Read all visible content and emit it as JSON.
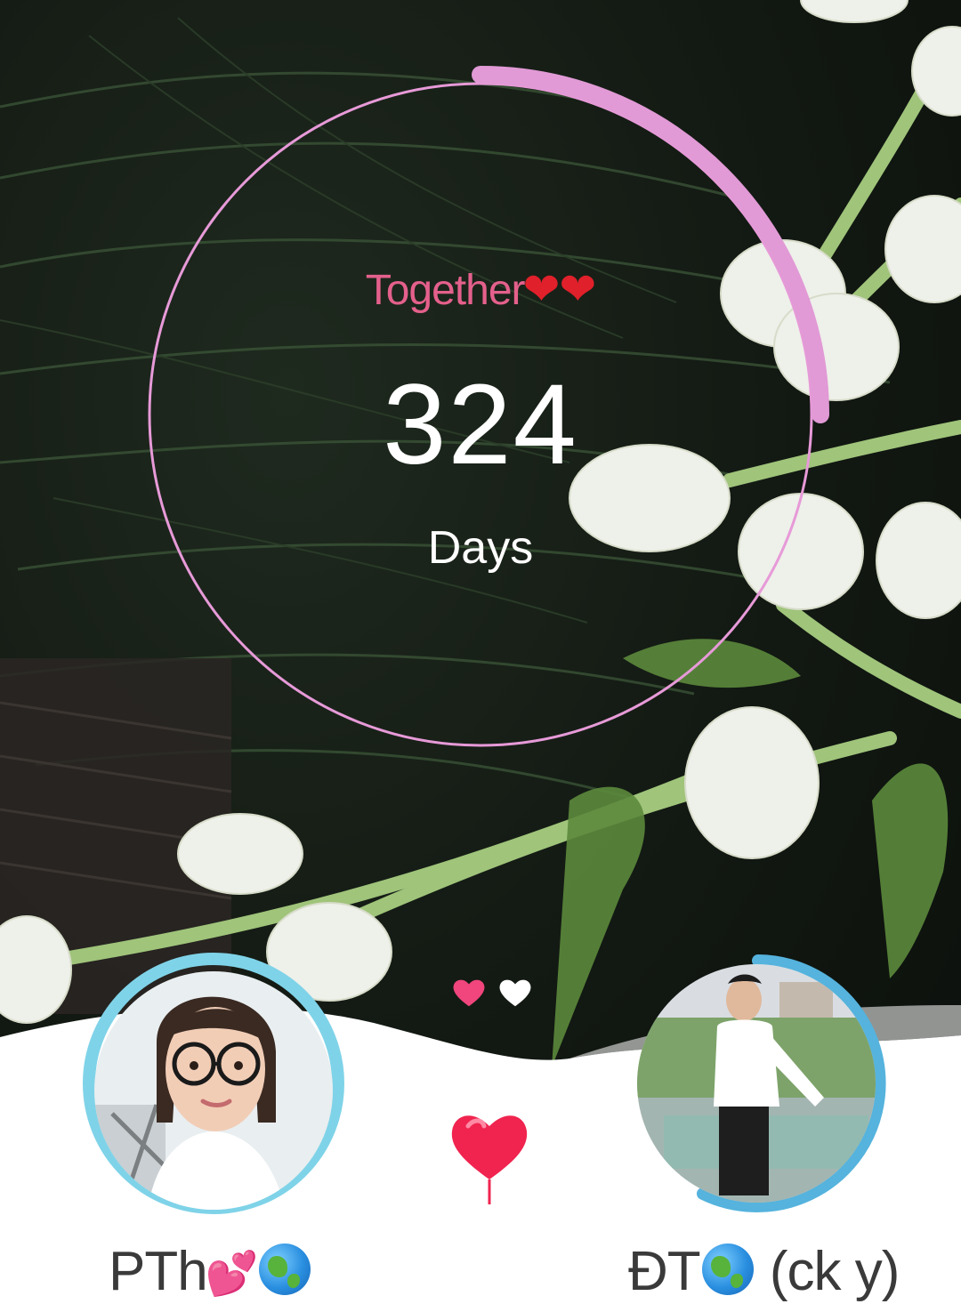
{
  "counter": {
    "title": "Together",
    "title_emoji": "❤❤",
    "count": "324",
    "unit": "Days",
    "progress": 0.25
  },
  "pager": {
    "pages": 2,
    "active_index": 0
  },
  "partners": {
    "left": {
      "name": "PTh",
      "name_suffix_emoji": "💕",
      "name_suffix_globe": "globe-emoji"
    },
    "right": {
      "name_prefix": "ĐT",
      "name_suffix": " (ck y)",
      "name_globe": "globe-emoji"
    }
  },
  "icons": {
    "center": "balloon-heart-icon"
  },
  "colors": {
    "ring_track": "#e79ad8",
    "ring_progress": "#e19ad6",
    "title_pink": "#e4608c",
    "avatar_ring": "#7fd3e8",
    "avatar_ring_right": "#55b3dd",
    "heart_red": "#f0244f"
  }
}
